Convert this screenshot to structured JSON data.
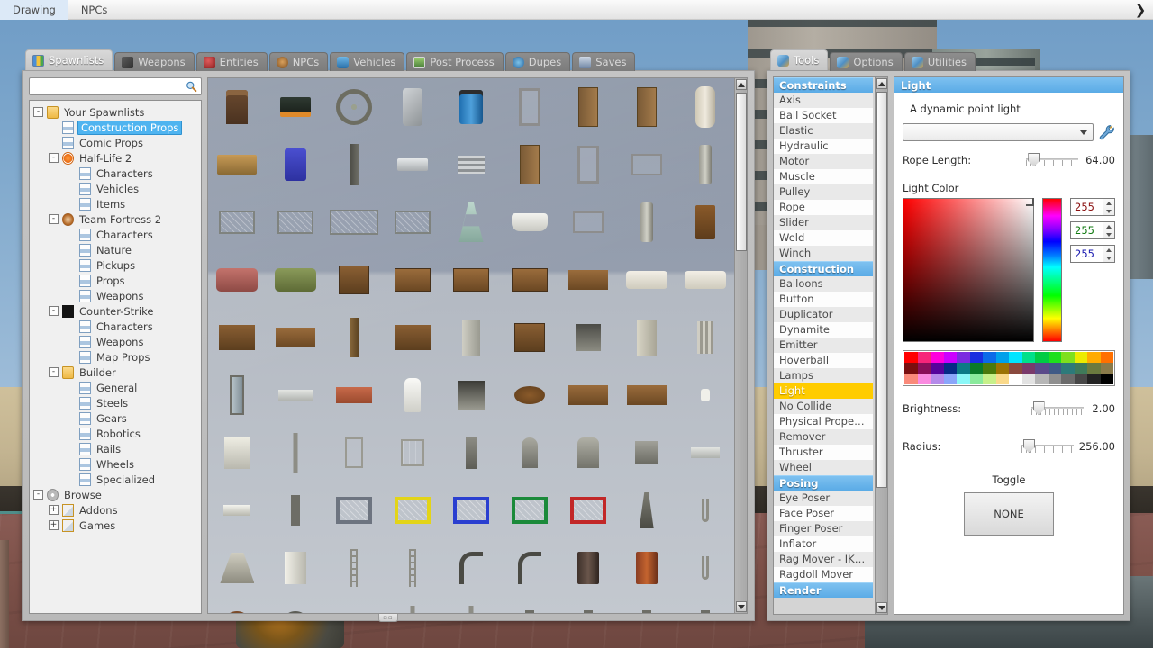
{
  "topbar": {
    "menus": [
      {
        "label": "Drawing",
        "name": "menu-drawing"
      },
      {
        "label": "NPCs",
        "name": "menu-npcs"
      }
    ],
    "chevron": "❯"
  },
  "spawn_window": {
    "tabs": [
      {
        "label": "Spawnlists",
        "icon": "spawnlists-icon",
        "active": true
      },
      {
        "label": "Weapons",
        "icon": "weapons-icon",
        "active": false
      },
      {
        "label": "Entities",
        "icon": "entities-icon",
        "active": false
      },
      {
        "label": "NPCs",
        "icon": "npcs-icon",
        "active": false
      },
      {
        "label": "Vehicles",
        "icon": "vehicles-icon",
        "active": false
      },
      {
        "label": "Post Process",
        "icon": "post-process-icon",
        "active": false
      },
      {
        "label": "Dupes",
        "icon": "dupes-icon",
        "active": false
      },
      {
        "label": "Saves",
        "icon": "saves-icon",
        "active": false
      }
    ],
    "search": {
      "value": "",
      "placeholder": ""
    },
    "tree": [
      {
        "label": "Your Spawnlists",
        "icon": "folder",
        "expander": "-",
        "indent": 0,
        "selected": false
      },
      {
        "label": "Construction Props",
        "icon": "doc",
        "expander": "",
        "indent": 1,
        "selected": true
      },
      {
        "label": "Comic Props",
        "icon": "doc",
        "expander": "",
        "indent": 1,
        "selected": false
      },
      {
        "label": "Half-Life 2",
        "icon": "hl2",
        "expander": "-",
        "indent": 1,
        "selected": false
      },
      {
        "label": "Characters",
        "icon": "doc",
        "expander": "",
        "indent": 2,
        "selected": false
      },
      {
        "label": "Vehicles",
        "icon": "doc",
        "expander": "",
        "indent": 2,
        "selected": false
      },
      {
        "label": "Items",
        "icon": "doc",
        "expander": "",
        "indent": 2,
        "selected": false
      },
      {
        "label": "Team Fortress 2",
        "icon": "tf2",
        "expander": "-",
        "indent": 1,
        "selected": false
      },
      {
        "label": "Characters",
        "icon": "doc",
        "expander": "",
        "indent": 2,
        "selected": false
      },
      {
        "label": "Nature",
        "icon": "doc",
        "expander": "",
        "indent": 2,
        "selected": false
      },
      {
        "label": "Pickups",
        "icon": "doc",
        "expander": "",
        "indent": 2,
        "selected": false
      },
      {
        "label": "Props",
        "icon": "doc",
        "expander": "",
        "indent": 2,
        "selected": false
      },
      {
        "label": "Weapons",
        "icon": "doc",
        "expander": "",
        "indent": 2,
        "selected": false
      },
      {
        "label": "Counter-Strike",
        "icon": "cs",
        "expander": "-",
        "indent": 1,
        "selected": false
      },
      {
        "label": "Characters",
        "icon": "doc",
        "expander": "",
        "indent": 2,
        "selected": false
      },
      {
        "label": "Weapons",
        "icon": "doc",
        "expander": "",
        "indent": 2,
        "selected": false
      },
      {
        "label": "Map Props",
        "icon": "doc",
        "expander": "",
        "indent": 2,
        "selected": false
      },
      {
        "label": "Builder",
        "icon": "folder",
        "expander": "-",
        "indent": 1,
        "selected": false
      },
      {
        "label": "General",
        "icon": "doc",
        "expander": "",
        "indent": 2,
        "selected": false
      },
      {
        "label": "Steels",
        "icon": "doc",
        "expander": "",
        "indent": 2,
        "selected": false
      },
      {
        "label": "Gears",
        "icon": "doc",
        "expander": "",
        "indent": 2,
        "selected": false
      },
      {
        "label": "Robotics",
        "icon": "doc",
        "expander": "",
        "indent": 2,
        "selected": false
      },
      {
        "label": "Rails",
        "icon": "doc",
        "expander": "",
        "indent": 2,
        "selected": false
      },
      {
        "label": "Wheels",
        "icon": "doc",
        "expander": "",
        "indent": 2,
        "selected": false
      },
      {
        "label": "Specialized",
        "icon": "doc",
        "expander": "",
        "indent": 2,
        "selected": false
      },
      {
        "label": "Browse",
        "icon": "gear",
        "expander": "-",
        "indent": 0,
        "selected": false
      },
      {
        "label": "Addons",
        "icon": "folder-box",
        "expander": "+",
        "indent": 1,
        "selected": false
      },
      {
        "label": "Games",
        "icon": "folder-box",
        "expander": "+",
        "indent": 1,
        "selected": false
      }
    ],
    "props": [
      "p-stool",
      "p-cans",
      "p-wheel",
      "p-panel",
      "p-barrel-blue",
      "p-frame",
      "p-door",
      "p-door",
      "p-tank",
      "p-bench",
      "p-chair",
      "p-lamp",
      "p-plate",
      "p-vent",
      "p-door",
      "p-frame",
      "p-rack",
      "p-cyl",
      "p-fence",
      "p-fence",
      "p-fence-w",
      "p-fence",
      "p-fount",
      "p-bath",
      "p-rack",
      "p-cyl",
      "p-woodchair",
      "p-sofa-red",
      "p-sofa-green",
      "p-cab",
      "p-dresser",
      "p-dresser",
      "p-dresser",
      "p-table",
      "p-mattress",
      "p-mattress",
      "p-desk",
      "p-table",
      "p-plank",
      "p-desk",
      "p-locker",
      "p-cab",
      "p-stove",
      "p-fridge",
      "p-rad",
      "p-mirror",
      "p-slab",
      "p-benchred",
      "p-sink",
      "p-oven",
      "p-rtable",
      "p-table",
      "p-table",
      "p-toilet",
      "p-washer",
      "p-post",
      "p-gate",
      "p-win",
      "p-grave1",
      "p-grave2",
      "p-grave3",
      "p-grave4",
      "p-slab2",
      "p-book",
      "p-cross",
      "p-bin-grey",
      "p-bin-yellow",
      "p-bin-blue",
      "p-bin-green",
      "p-bin-red",
      "p-obelisk",
      "p-hook",
      "p-cone",
      "p-cabinet",
      "p-ladder",
      "p-ladder",
      "p-pipe",
      "p-pipe",
      "p-drum-dark",
      "p-drum-rust",
      "p-hook",
      "p-gearwheel",
      "p-gearwheel2",
      "p-vent2",
      "p-post",
      "p-post",
      "p-cross",
      "p-cross",
      "p-cross",
      "p-cross"
    ]
  },
  "tool_window": {
    "tabs": [
      {
        "label": "Tools",
        "icon": "wrench-icon",
        "active": true
      },
      {
        "label": "Options",
        "icon": "wrench-icon",
        "active": false
      },
      {
        "label": "Utilities",
        "icon": "wrench-icon",
        "active": false
      }
    ],
    "categories": [
      {
        "header": "Constraints",
        "items": [
          "Axis",
          "Ball Socket",
          "Elastic",
          "Hydraulic",
          "Motor",
          "Muscle",
          "Pulley",
          "Rope",
          "Slider",
          "Weld",
          "Winch"
        ]
      },
      {
        "header": "Construction",
        "items": [
          "Balloons",
          "Button",
          "Duplicator",
          "Dynamite",
          "Emitter",
          "Hoverball",
          "Lamps",
          "Light",
          "No Collide",
          "Physical Properties",
          "Remover",
          "Thruster",
          "Wheel"
        ]
      },
      {
        "header": "Posing",
        "items": [
          "Eye Poser",
          "Face Poser",
          "Finger Poser",
          "Inflator",
          "Rag Mover - IK Ch…",
          "Ragdoll Mover"
        ]
      },
      {
        "header": "Render",
        "items": []
      }
    ],
    "selected_tool": "Light",
    "panel": {
      "title": "Light",
      "description": "A dynamic point light",
      "preset_value": "",
      "rope_length_label": "Rope Length:",
      "rope_length_value": "64.00",
      "light_color_label": "Light Color",
      "rgb": {
        "r": "255",
        "g": "255",
        "b": "255"
      },
      "brightness_label": "Brightness:",
      "brightness_value": "2.00",
      "radius_label": "Radius:",
      "radius_value": "256.00",
      "toggle_label": "Toggle",
      "toggle_button": "NONE"
    },
    "palette": [
      [
        "#ff0000",
        "#f7257a",
        "#ff00dd",
        "#cc00ff",
        "#7b2be0",
        "#1a2ee0",
        "#0c6ae8",
        "#00a0ea",
        "#00e5ff",
        "#00e08a",
        "#00cc44",
        "#1ee01e",
        "#7ee01e",
        "#ecea00",
        "#ffab00",
        "#ff7000"
      ],
      [
        "#7a0f0f",
        "#8a0f59",
        "#55039c",
        "#062a86",
        "#0c7a86",
        "#0a7a28",
        "#4a7a0c",
        "#9c7203",
        "#8a4a3f",
        "#7a3a6b",
        "#5a4a8a",
        "#3f5a86",
        "#2d7a7a",
        "#3f7a5a",
        "#6b7a3f",
        "#8a7a4a"
      ],
      [
        "#fa8a7a",
        "#fa8ae0",
        "#b58aea",
        "#8aa6fa",
        "#8af7f7",
        "#8aea9c",
        "#c7f08a",
        "#fad98a",
        "#ffffff",
        "#e2e2e2",
        "#b6b6b6",
        "#8f8f8f",
        "#6b6b6b",
        "#474747",
        "#232323",
        "#000000"
      ]
    ]
  }
}
